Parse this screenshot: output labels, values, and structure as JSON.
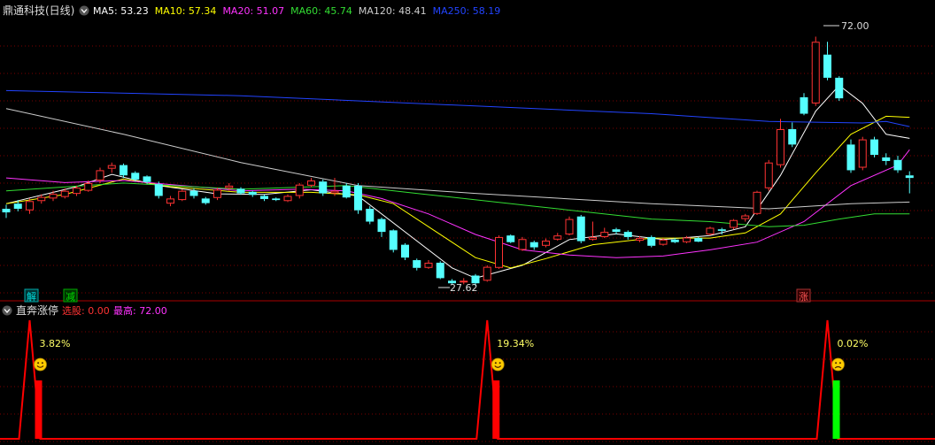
{
  "header": {
    "title": "鼎通科技(日线)",
    "ma": [
      {
        "label": "MA5: 53.23",
        "color": "#ffffff"
      },
      {
        "label": "MA10: 57.34",
        "color": "#ffff00"
      },
      {
        "label": "MA20: 51.07",
        "color": "#ff33ff"
      },
      {
        "label": "MA60: 45.74",
        "color": "#33dd33"
      },
      {
        "label": "MA120: 48.41",
        "color": "#cccccc"
      },
      {
        "label": "MA250: 58.19",
        "color": "#2244ff"
      }
    ]
  },
  "price_labels": {
    "high": "72.00",
    "low": "27.62"
  },
  "markers": [
    {
      "text": "解",
      "color": "#00cccc"
    },
    {
      "text": "减",
      "color": "#00cc00"
    },
    {
      "text": "涨",
      "color": "#ff3333"
    }
  ],
  "indicator": {
    "name": "直奔涨停",
    "stock_label": "选股: 0.00",
    "high_label": "最高: 72.00",
    "percents": [
      "3.82%",
      "19.34%",
      "0.02%"
    ],
    "faces": [
      "smile-icon",
      "smile-icon",
      "frown-icon"
    ],
    "bar_colors": [
      "#ff0000",
      "#ff0000",
      "#00ff00"
    ]
  },
  "colors": {
    "up": "#ff3333",
    "down": "#55ffff",
    "grid": "#7a0000",
    "indicator_line": "#ff0000"
  },
  "chart_data": [
    {
      "type": "candlestick",
      "title": "鼎通科技(日线)",
      "ylim": [
        24,
        76
      ],
      "candles": [
        [
          39.5,
          38.8,
          40.3,
          37.7
        ],
        [
          40.5,
          39.5,
          41.2,
          39.0
        ],
        [
          39.2,
          41.0,
          41.5,
          38.5
        ],
        [
          41.0,
          41.8,
          42.3,
          40.5
        ],
        [
          41.5,
          42.4,
          43.0,
          41.0
        ],
        [
          41.8,
          43.0,
          43.5,
          41.5
        ],
        [
          42.4,
          43.6,
          44.0,
          42.0
        ],
        [
          43.0,
          44.5,
          45.0,
          42.8
        ],
        [
          45.0,
          47.0,
          47.5,
          44.5
        ],
        [
          47.3,
          48.0,
          48.5,
          46.5
        ],
        [
          48.0,
          46.0,
          48.3,
          45.5
        ],
        [
          46.5,
          45.2,
          46.8,
          44.8
        ],
        [
          45.8,
          44.7,
          46.0,
          44.3
        ],
        [
          44.3,
          42.0,
          44.8,
          41.5
        ],
        [
          40.5,
          41.5,
          42.0,
          40.0
        ],
        [
          41.2,
          43.0,
          43.3,
          41.0
        ],
        [
          43.0,
          42.0,
          43.5,
          41.5
        ],
        [
          41.5,
          40.6,
          41.8,
          40.3
        ],
        [
          41.6,
          43.2,
          43.6,
          41.2
        ],
        [
          43.5,
          44.0,
          44.5,
          43.0
        ],
        [
          43.4,
          42.5,
          43.7,
          42.2
        ],
        [
          42.8,
          42.2,
          43.0,
          41.8
        ],
        [
          42.0,
          41.4,
          42.3,
          41.0
        ],
        [
          41.5,
          41.2,
          41.7,
          41.0
        ],
        [
          41.0,
          42.0,
          42.3,
          40.8
        ],
        [
          42.0,
          44.2,
          44.5,
          41.5
        ],
        [
          44.0,
          45.0,
          45.5,
          43.7
        ],
        [
          44.8,
          42.5,
          45.2,
          42.0
        ],
        [
          42.5,
          43.0,
          45.5,
          42.0
        ],
        [
          44.0,
          41.7,
          44.5,
          41.5
        ],
        [
          44.0,
          39.2,
          44.5,
          38.5
        ],
        [
          39.5,
          37.0,
          40.0,
          36.5
        ],
        [
          37.5,
          35.0,
          37.8,
          34.0
        ],
        [
          35.3,
          31.5,
          35.5,
          31.0
        ],
        [
          32.5,
          30.0,
          32.8,
          29.5
        ],
        [
          29.5,
          28.0,
          29.8,
          27.5
        ],
        [
          28.0,
          29.0,
          29.5,
          27.8
        ],
        [
          29.0,
          26.0,
          29.3,
          25.8
        ],
        [
          25.5,
          25.0,
          25.8,
          24.8
        ],
        [
          25.2,
          25.5,
          26.0,
          24.8
        ],
        [
          26.5,
          25.0,
          26.8,
          24.5
        ],
        [
          25.5,
          28.2,
          28.5,
          25.3
        ],
        [
          28.0,
          34.0,
          34.3,
          27.8
        ],
        [
          34.3,
          33.0,
          34.5,
          32.8
        ],
        [
          31.5,
          33.6,
          34.0,
          31.3
        ],
        [
          33.0,
          32.0,
          33.3,
          31.5
        ],
        [
          32.3,
          33.3,
          33.7,
          32.0
        ],
        [
          33.5,
          34.3,
          34.8,
          33.3
        ],
        [
          34.5,
          37.5,
          38.0,
          34.3
        ],
        [
          38.0,
          33.2,
          38.3,
          32.8
        ],
        [
          33.5,
          34.0,
          37.0,
          33.3
        ],
        [
          34.0,
          35.0,
          35.8,
          33.8
        ],
        [
          35.5,
          35.0,
          35.8,
          34.5
        ],
        [
          35.0,
          34.0,
          35.3,
          33.5
        ],
        [
          33.3,
          33.8,
          34.2,
          33.0
        ],
        [
          34.0,
          32.3,
          34.3,
          32.0
        ],
        [
          32.5,
          33.5,
          33.8,
          32.3
        ],
        [
          33.5,
          33.0,
          33.8,
          32.8
        ],
        [
          33.0,
          33.9,
          34.2,
          32.8
        ],
        [
          33.8,
          33.1,
          34.0,
          33.0
        ],
        [
          34.5,
          35.8,
          36.0,
          34.3
        ],
        [
          35.5,
          35.2,
          35.8,
          34.5
        ],
        [
          35.8,
          37.3,
          37.5,
          35.5
        ],
        [
          37.5,
          38.2,
          38.5,
          37.0
        ],
        [
          38.5,
          42.8,
          43.0,
          38.3
        ],
        [
          43.5,
          48.5,
          49.0,
          43.0
        ],
        [
          48.0,
          55.0,
          57.0,
          47.5
        ],
        [
          55.0,
          52.0,
          56.3,
          51.5
        ],
        [
          61.2,
          58.0,
          62.0,
          57.7
        ],
        [
          60.0,
          72.0,
          73.0,
          59.5
        ],
        [
          69.5,
          65.0,
          72.0,
          64.5
        ],
        [
          65.0,
          61.0,
          65.3,
          60.5
        ],
        [
          52.0,
          47.0,
          53.0,
          46.5
        ],
        [
          47.5,
          53.0,
          53.5,
          47.0
        ],
        [
          53.0,
          50.0,
          53.5,
          49.5
        ],
        [
          49.5,
          48.8,
          50.3,
          48.0
        ],
        [
          49.0,
          47.0,
          49.8,
          46.5
        ],
        [
          46.0,
          45.5,
          46.8,
          42.5
        ]
      ],
      "series": [
        {
          "name": "MA5",
          "color": "#ffffff",
          "points": [
            [
              0,
              40.5
            ],
            [
              6,
              43.8
            ],
            [
              9,
              46.2
            ],
            [
              13,
              44.0
            ],
            [
              18,
              42.4
            ],
            [
              22,
              42.3
            ],
            [
              26,
              43.2
            ],
            [
              30,
              42.0
            ],
            [
              34,
              35.0
            ],
            [
              38,
              28.0
            ],
            [
              40,
              26.0
            ],
            [
              44,
              28.5
            ],
            [
              48,
              33.5
            ],
            [
              52,
              34.6
            ],
            [
              56,
              33.5
            ],
            [
              60,
              34.3
            ],
            [
              63,
              36.0
            ],
            [
              66,
              46.0
            ],
            [
              69,
              58.5
            ],
            [
              71,
              63.5
            ],
            [
              73,
              60.0
            ],
            [
              75,
              54.0
            ],
            [
              77,
              53.2
            ]
          ]
        },
        {
          "name": "MA10",
          "color": "#ffff00",
          "points": [
            [
              0,
              40.5
            ],
            [
              5,
              42.3
            ],
            [
              10,
              45.3
            ],
            [
              14,
              43.8
            ],
            [
              20,
              42.7
            ],
            [
              26,
              42.7
            ],
            [
              30,
              42.2
            ],
            [
              33,
              40.5
            ],
            [
              36,
              36.0
            ],
            [
              40,
              30.0
            ],
            [
              43,
              28.0
            ],
            [
              46,
              29.8
            ],
            [
              50,
              32.5
            ],
            [
              55,
              33.8
            ],
            [
              60,
              33.8
            ],
            [
              63,
              34.8
            ],
            [
              66,
              38.5
            ],
            [
              69,
              46.5
            ],
            [
              72,
              54.0
            ],
            [
              75,
              57.5
            ],
            [
              77,
              57.3
            ]
          ]
        },
        {
          "name": "MA20",
          "color": "#ff33ff",
          "points": [
            [
              0,
              45.5
            ],
            [
              5,
              44.6
            ],
            [
              10,
              45.0
            ],
            [
              15,
              44.0
            ],
            [
              20,
              43.0
            ],
            [
              25,
              43.3
            ],
            [
              29,
              43.0
            ],
            [
              32,
              41.5
            ],
            [
              36,
              38.5
            ],
            [
              40,
              34.5
            ],
            [
              44,
              31.5
            ],
            [
              48,
              30.5
            ],
            [
              52,
              30.0
            ],
            [
              56,
              30.3
            ],
            [
              60,
              31.5
            ],
            [
              64,
              33.0
            ],
            [
              68,
              37.0
            ],
            [
              72,
              44.0
            ],
            [
              76,
              48.0
            ],
            [
              77,
              51.0
            ]
          ]
        },
        {
          "name": "MA60",
          "color": "#33dd33",
          "points": [
            [
              0,
              43.0
            ],
            [
              10,
              44.5
            ],
            [
              20,
              43.3
            ],
            [
              29,
              44.0
            ],
            [
              35,
              42.5
            ],
            [
              45,
              40.0
            ],
            [
              55,
              37.5
            ],
            [
              60,
              37.0
            ],
            [
              65,
              36.0
            ],
            [
              68,
              36.3
            ],
            [
              71,
              37.5
            ],
            [
              74,
              38.5
            ],
            [
              77,
              38.5
            ]
          ]
        },
        {
          "name": "MA120",
          "color": "#cccccc",
          "points": [
            [
              0,
              59.0
            ],
            [
              10,
              54.0
            ],
            [
              20,
              48.5
            ],
            [
              30,
              44.0
            ],
            [
              40,
              42.5
            ],
            [
              55,
              40.5
            ],
            [
              65,
              39.5
            ],
            [
              72,
              40.5
            ],
            [
              77,
              40.8
            ]
          ]
        },
        {
          "name": "MA250",
          "color": "#2244ff",
          "points": [
            [
              0,
              62.5
            ],
            [
              20,
              61.5
            ],
            [
              40,
              59.5
            ],
            [
              55,
              58.0
            ],
            [
              65,
              56.5
            ],
            [
              73,
              56.2
            ],
            [
              75,
              56.5
            ],
            [
              77,
              55.5
            ]
          ]
        }
      ]
    },
    {
      "type": "line",
      "title": "直奔涨停",
      "ylim": [
        0,
        100
      ],
      "signals": [
        {
          "index": 2,
          "percent": "3.82%",
          "bar": "#ff0000"
        },
        {
          "index": 41,
          "percent": "19.34%",
          "bar": "#ff0000"
        },
        {
          "index": 70,
          "percent": "0.02%",
          "bar": "#00ff00"
        }
      ]
    }
  ]
}
